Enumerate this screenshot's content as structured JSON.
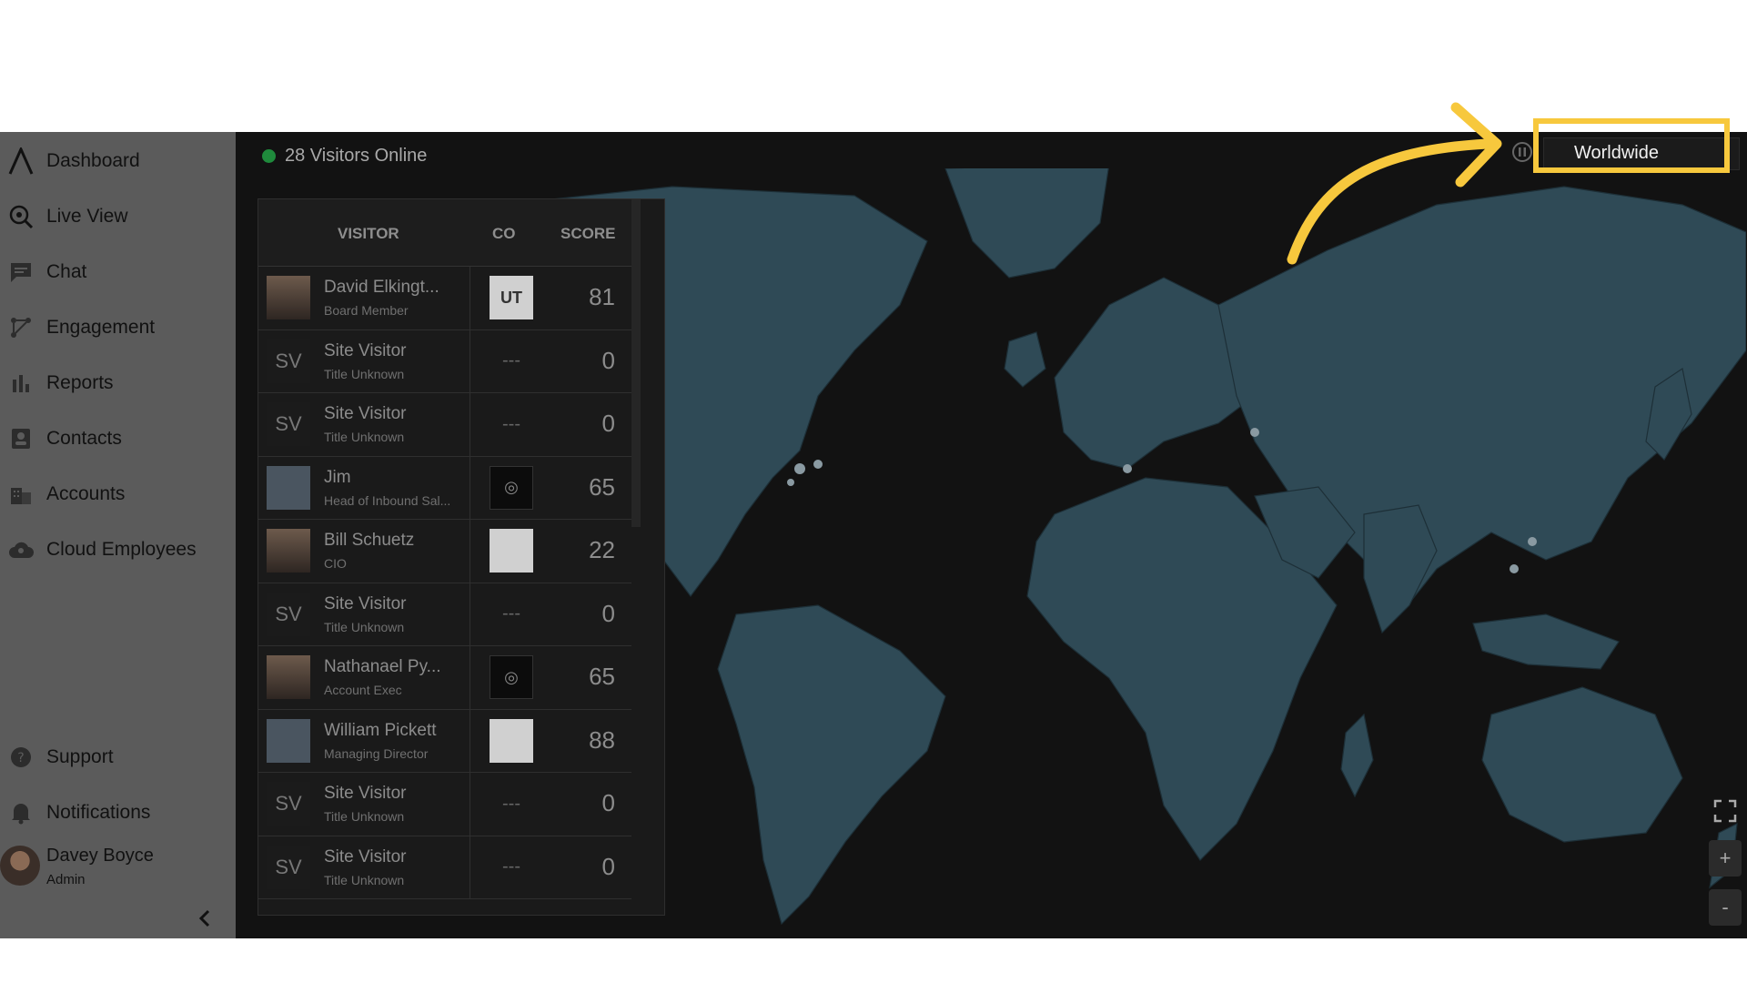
{
  "sidebar": {
    "items": [
      {
        "label": "Dashboard",
        "icon": "logo-icon"
      },
      {
        "label": "Live View",
        "icon": "live-view-icon"
      },
      {
        "label": "Chat",
        "icon": "chat-icon"
      },
      {
        "label": "Engagement",
        "icon": "engagement-icon"
      },
      {
        "label": "Reports",
        "icon": "reports-icon"
      },
      {
        "label": "Contacts",
        "icon": "contacts-icon"
      },
      {
        "label": "Accounts",
        "icon": "accounts-icon"
      },
      {
        "label": "Cloud Employees",
        "icon": "cloud-icon"
      }
    ],
    "bottom_items": [
      {
        "label": "Support",
        "icon": "help-icon"
      },
      {
        "label": "Notifications",
        "icon": "bell-icon"
      }
    ],
    "user": {
      "name": "Davey Boyce",
      "role": "Admin"
    },
    "collapse_icon": "chevron-left-icon"
  },
  "header": {
    "online_text": "28 Visitors Online",
    "online_color": "#1f8a3c",
    "region": "Worldwide"
  },
  "table": {
    "columns": {
      "visitor": "VISITOR",
      "company": "CO",
      "score": "SCORE"
    },
    "rows": [
      {
        "avatar": "photo",
        "initials": "",
        "name": "David Elkingt...",
        "title": "Board Member",
        "company": "UT",
        "company_style": "light",
        "score": "81"
      },
      {
        "avatar": "initials",
        "initials": "SV",
        "name": "Site Visitor",
        "title": "Title Unknown",
        "company": "---",
        "company_style": "dash",
        "score": "0"
      },
      {
        "avatar": "initials",
        "initials": "SV",
        "name": "Site Visitor",
        "title": "Title Unknown",
        "company": "---",
        "company_style": "dash",
        "score": "0"
      },
      {
        "avatar": "placeholder",
        "initials": "",
        "name": "Jim",
        "title": "Head of Inbound Sal...",
        "company": "◎",
        "company_style": "dark",
        "score": "65"
      },
      {
        "avatar": "photo",
        "initials": "",
        "name": "Bill Schuetz",
        "title": "CIO",
        "company": "",
        "company_style": "light",
        "score": "22"
      },
      {
        "avatar": "initials",
        "initials": "SV",
        "name": "Site Visitor",
        "title": "Title Unknown",
        "company": "---",
        "company_style": "dash",
        "score": "0"
      },
      {
        "avatar": "photo",
        "initials": "",
        "name": "Nathanael Py...",
        "title": "Account Exec",
        "company": "◎",
        "company_style": "dark",
        "score": "65"
      },
      {
        "avatar": "placeholder",
        "initials": "",
        "name": "William Pickett",
        "title": "Managing Director",
        "company": "",
        "company_style": "light",
        "score": "88"
      },
      {
        "avatar": "initials",
        "initials": "SV",
        "name": "Site Visitor",
        "title": "Title Unknown",
        "company": "---",
        "company_style": "dash",
        "score": "0"
      },
      {
        "avatar": "initials",
        "initials": "SV",
        "name": "Site Visitor",
        "title": "Title Unknown",
        "company": "---",
        "company_style": "dash",
        "score": "0"
      }
    ]
  },
  "map": {
    "land_color": "#2f4a56",
    "ocean_color": "#121212",
    "visitor_marker_color": "#8a9aa2"
  },
  "controls": {
    "zoom_in": "+",
    "zoom_out": "-",
    "fullscreen_icon": "fullscreen-icon",
    "pause_icon": "pause-icon"
  },
  "annotation": {
    "highlight_color": "#f7c83d"
  }
}
